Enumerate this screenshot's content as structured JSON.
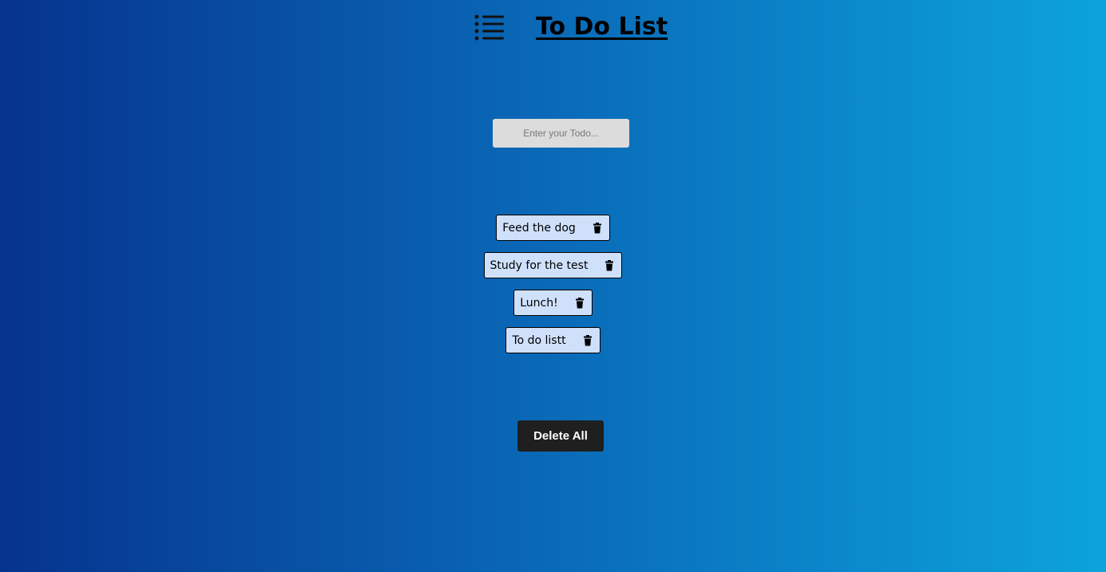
{
  "header": {
    "title": "To Do List",
    "menu_icon": "list-icon"
  },
  "input": {
    "placeholder": "Enter your Todo...",
    "value": ""
  },
  "todos": [
    {
      "text": "Feed the dog",
      "icon": "trash-icon"
    },
    {
      "text": "Study for the test",
      "icon": "trash-icon"
    },
    {
      "text": "Lunch!",
      "icon": "trash-icon"
    },
    {
      "text": "To do listt",
      "icon": "trash-icon"
    }
  ],
  "actions": {
    "delete_all_label": "Delete All"
  },
  "colors": {
    "background_start": "#06338e",
    "background_end": "#0ca3dc",
    "todo_item_bg": "#cfe0fb",
    "input_bg": "#dcdcdc",
    "button_bg": "#1f1f1f"
  }
}
